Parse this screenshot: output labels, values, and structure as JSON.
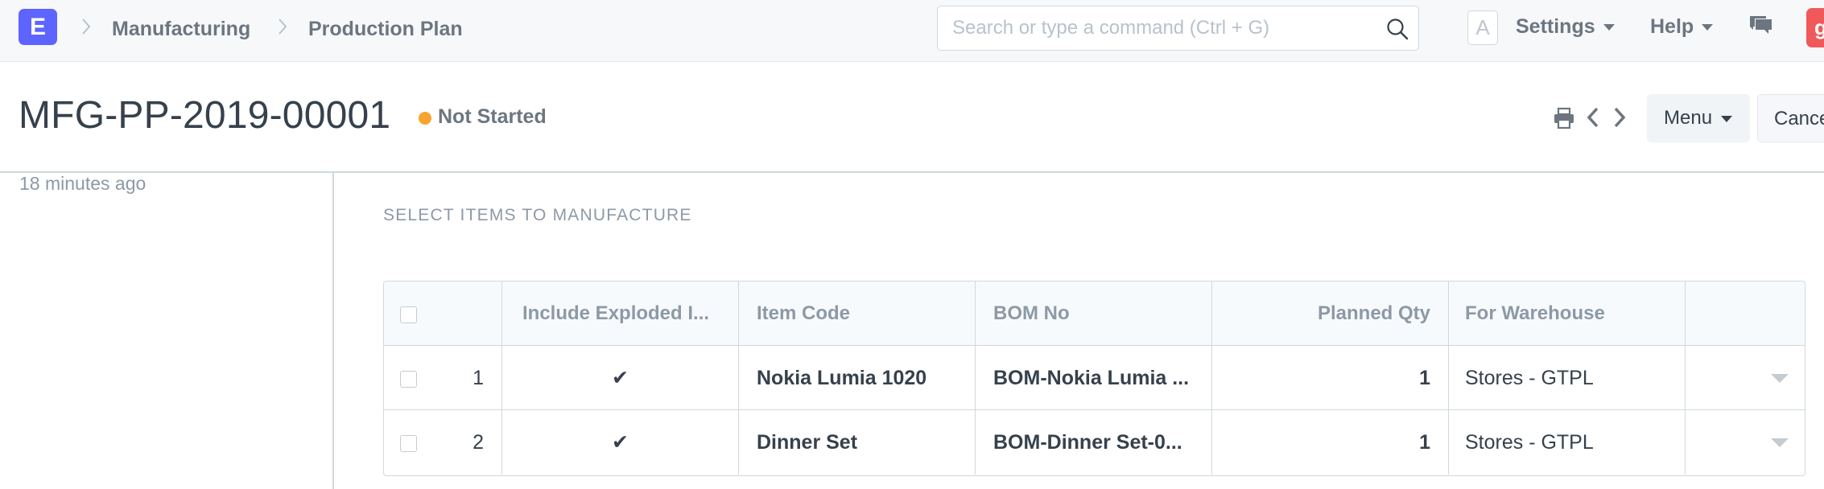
{
  "navbar": {
    "logo": "E",
    "breadcrumbs": [
      "Manufacturing",
      "Production Plan"
    ],
    "search_placeholder": "Search or type a command (Ctrl + G)",
    "avatar_letter": "A",
    "settings_label": "Settings",
    "help_label": "Help",
    "user_initial": "g"
  },
  "page": {
    "title": "MFG-PP-2019-00001",
    "status": "Not Started",
    "status_color": "#f8a42d",
    "menu_label": "Menu",
    "cancel_label": "Cancel"
  },
  "sidebar": {
    "modified": "18 minutes ago"
  },
  "section": {
    "title": "SELECT ITEMS TO MANUFACTURE"
  },
  "grid": {
    "columns": [
      "Include Exploded I...",
      "Item Code",
      "BOM No",
      "Planned Qty",
      "For Warehouse"
    ],
    "rows": [
      {
        "idx": "1",
        "include_exploded": "✔",
        "item_code": "Nokia Lumia 1020",
        "bom_no": "BOM-Nokia Lumia ...",
        "planned_qty": "1",
        "warehouse": "Stores - GTPL"
      },
      {
        "idx": "2",
        "include_exploded": "✔",
        "item_code": "Dinner Set",
        "bom_no": "BOM-Dinner Set-0...",
        "planned_qty": "1",
        "warehouse": "Stores - GTPL"
      }
    ]
  },
  "icons": {
    "brand": "#5e64ff",
    "user_badge": "#f0595a"
  }
}
